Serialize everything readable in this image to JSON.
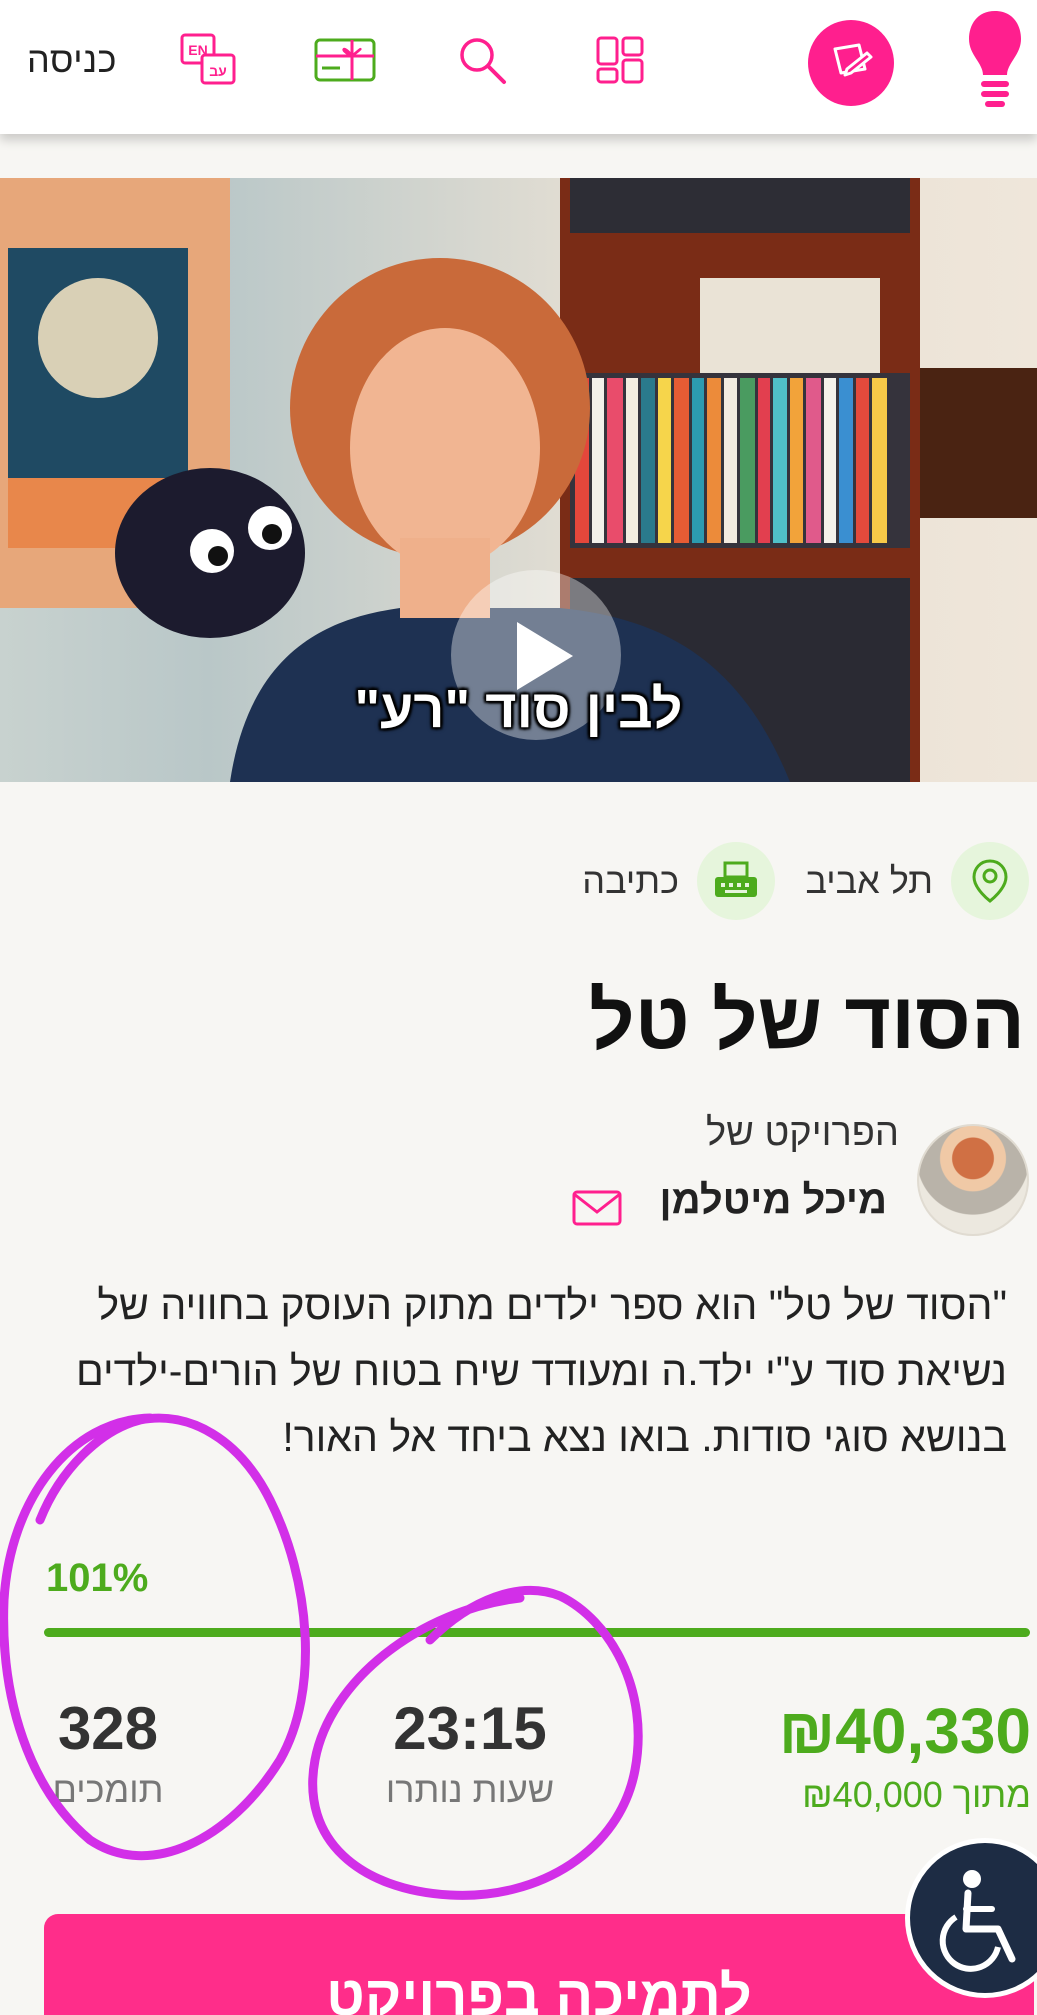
{
  "colors": {
    "brand_pink": "#ff1f8e",
    "progress_green": "#4dab1d",
    "annotation_purple": "#d22fe8",
    "accessibility_navy": "#1d2c44"
  },
  "header": {
    "login_label": "כניסה",
    "icons": [
      "language-icon",
      "gift-card-icon",
      "search-icon",
      "grid-icon",
      "create-project-icon",
      "lightbulb-icon"
    ],
    "language_icon_labels": {
      "en": "EN",
      "he": "עב"
    }
  },
  "video": {
    "caption": "לבין סוד \"רע\""
  },
  "meta": {
    "location": "תל אביב",
    "category": "כתיבה"
  },
  "project": {
    "title": "הסוד של טל",
    "owner_prefix": "הפרויקט של",
    "owner_name": "מיכל מיטלמן",
    "description": "\"הסוד של טל\" הוא ספר ילדים מתוק העוסק בחוויה של נשיאת סוד ע\"י ילד.ה ומעודד שיח בטוח של הורים-ילדים בנושא סוגי סודות. בואו נצא ביחד אל האור!"
  },
  "stats": {
    "percent_label": "101%",
    "progress_fraction": 1.0,
    "raised": "₪40,330",
    "goal_label": "מתוך ₪40,000",
    "hours_left": "23:15",
    "hours_left_label": "שעות נותרו",
    "supporters": "328",
    "supporters_label": "תומכים"
  },
  "cta": {
    "support_label": "לתמיכה בפרויקט"
  }
}
